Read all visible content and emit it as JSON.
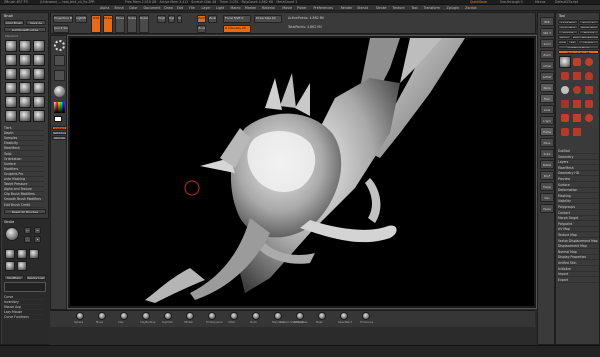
{
  "app": {
    "title": "ZBrush 4R7 P3",
    "title_file": "(Unknown) — tool_bird_v4_fix.ZPR",
    "title_info": "Free Mem 2.018 GB · Active Mem 3.411 · Scratch Disk 48 · Timer 0.031 · PolyCount 4.862 Mil · MeshCount 1",
    "quick_save": "QuickSave",
    "see_through": "See-through 0",
    "menus": "Menus",
    "default_zscript": "DefaultZScript"
  },
  "menubar": [
    "Alpha",
    "Brush",
    "Color",
    "Document",
    "Draw",
    "Edit",
    "File",
    "Layer",
    "Light",
    "Macro",
    "Marker",
    "Material",
    "Movie",
    "Picker",
    "Preferences",
    "Render",
    "Stencil",
    "Stroke",
    "Texture",
    "Tool",
    "Transform",
    "Zplugin",
    "Zscript"
  ],
  "top_toolbar": {
    "projection_master": "Projection Master",
    "lightbox": "LightBox",
    "quick_sketch": "Quick Sketch",
    "edit": "Edit",
    "draw": "Draw",
    "move": "Move",
    "scale": "Scale",
    "rotate": "Rotate",
    "mrgb": "Mrgb",
    "rgb": "Rgb",
    "m": "M",
    "zadd": "Zadd",
    "zsub": "Zsub",
    "zcut": "Zcut",
    "focal_shift": "Focal Shift 0",
    "draw_size": "Draw Size 64",
    "z_intensity": "Z Intensity 25",
    "active_points": "ActivePoints: 4.862 Mil",
    "total_points": "TotalPoints: 4.862 Mil"
  },
  "left_panel": {
    "header": "Brush",
    "load_brush": "Load Brush",
    "save_as": "Save As",
    "lightbox_brushes": "Lightbox▸Brushes",
    "standard": "Standard",
    "sections": [
      "Tiers",
      "Depth",
      "Samples",
      "Elasticity",
      "FiberMesh",
      "Twist",
      "Orientation",
      "Surface",
      "Modifiers",
      "Sculptris Pro",
      "Auto Masking",
      "Tablet Pressure",
      "Alpha and Texture",
      "Clip Brush Modifiers",
      "Smooth Brush Modifiers",
      "Edit Brush Credit"
    ],
    "reset_all": "Reset All Brushes",
    "stroke_header": "Stroke",
    "stroke_items": [
      "Dots",
      "DragRect",
      "FreeHand",
      "Spray"
    ],
    "modifiers": "Modifiers",
    "replay_last": "Replay Last",
    "bottom_items": [
      "Curve",
      "Inventory",
      "Mouse Avg",
      "Lazy Mouse",
      "Curve Functions"
    ]
  },
  "left_shelf": {
    "gradient": "Gradient",
    "switch_color": "SwitchColor",
    "alternate": "Alternate"
  },
  "right_panel": {
    "header": "Tool",
    "load_tool": "Load Tool",
    "save_as": "Save As",
    "copy_tool": "Copy Tool",
    "paste_tool": "Paste Tool",
    "import": "Import",
    "export": "Export",
    "clone": "Clone",
    "make_polymesh": "Make PolyMesh3D",
    "goz": "GoZ",
    "all": "All",
    "visible": "Visible",
    "lightbox_tools": "Lightbox▸Tools",
    "current_tool": "Bird_v4_fix: 48",
    "sections": [
      "SubTool",
      "Geometry",
      "Layers",
      "FiberMesh",
      "Geometry HD",
      "Preview",
      "Surface",
      "Deformation",
      "Masking",
      "Visibility",
      "Polygroups",
      "Contact",
      "Morph Target",
      "Polypaint",
      "UV Map",
      "Texture Map",
      "Vector Displacement Map",
      "Displacement Map",
      "Normal Map",
      "Display Properties",
      "Unified Skin",
      "Initialize",
      "Import",
      "Export"
    ]
  },
  "right_shelf": {
    "items": [
      "BPR",
      "SPix 3",
      "Scroll",
      "Zoom",
      "Actual",
      "AAHalf",
      "Persp",
      "Floor",
      "Local",
      "L.Sym",
      "Frame",
      "Move",
      "Scale",
      "Rotate",
      "PolyF",
      "Transp",
      "Solo",
      "Xpose"
    ]
  },
  "document": {
    "zoom": "Zoom2D",
    "canvas_background": "#000000"
  },
  "bottom_shelf": {
    "items": [
      "Sphere",
      "Move",
      "Clay",
      "ClayBuildup",
      "DamStd",
      "hPolish",
      "TrimDynamic",
      "Inflat",
      "Pinch",
      "Standard",
      "Smooth",
      "Mask",
      "SelectRect",
      "TrimCurve"
    ],
    "palette_label": "Custom Shelf Brushes"
  },
  "colors": {
    "accent": "#e86a17",
    "ui_bg": "#2b2b2b",
    "panel": "#3a3a3a",
    "brush_cursor": "#c72a2a"
  }
}
